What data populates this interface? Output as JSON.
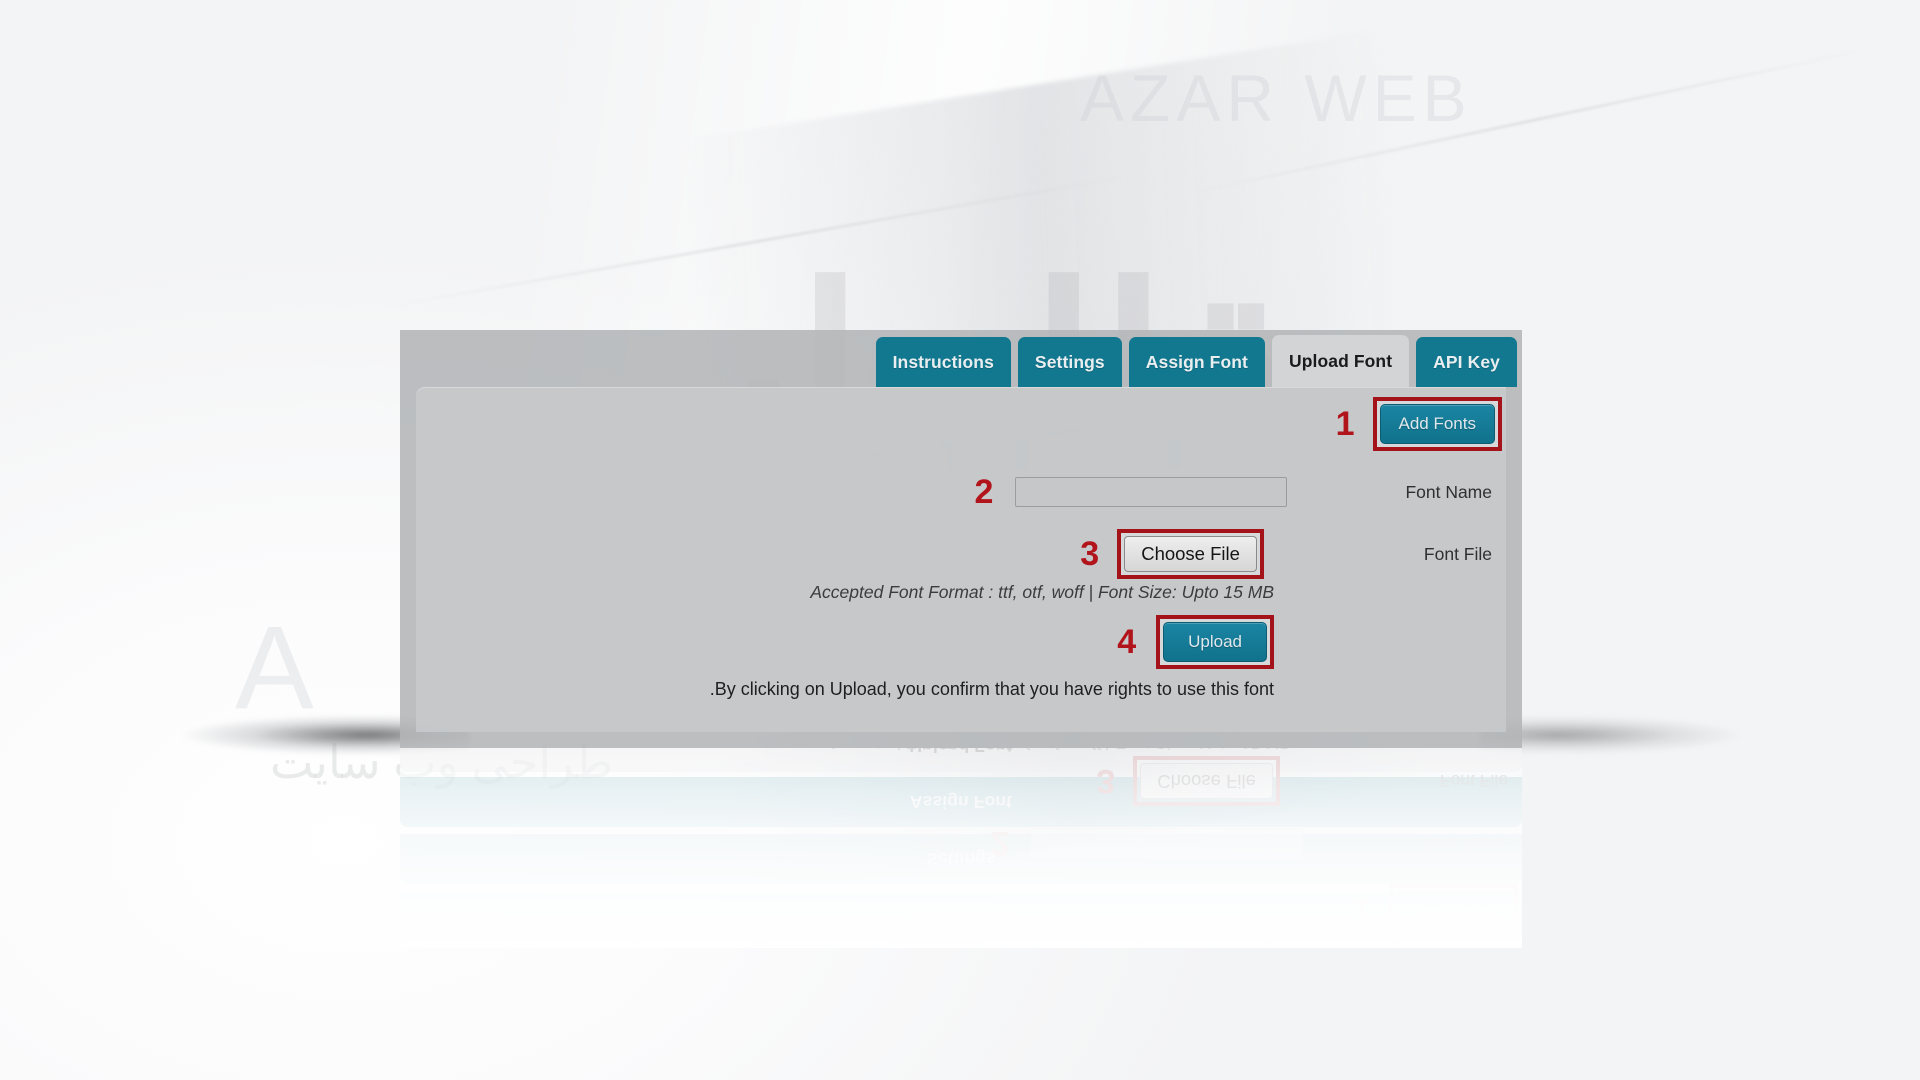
{
  "background": {
    "watermark_main": "قالبتاپ",
    "watermark_latin": "A Z A R S",
    "watermark_sub": "طراحی وب سایت",
    "watermark_faint": "AZAR WEB"
  },
  "panel": {
    "tabs": [
      {
        "label": "Instructions",
        "active": false
      },
      {
        "label": "Settings",
        "active": false
      },
      {
        "label": "Assign Font",
        "active": false
      },
      {
        "label": "Upload Font",
        "active": true
      },
      {
        "label": "API Key",
        "active": false
      }
    ],
    "form": {
      "add_fonts_button": "Add Fonts",
      "font_name_label": "Font Name",
      "font_name_value": "",
      "font_name_placeholder": "",
      "font_file_label": "Font File",
      "choose_file_button": "Choose File",
      "format_hint": "Accepted Font Format : ttf, otf, woff | Font Size: Upto 15 MB",
      "upload_button": "Upload",
      "confirm_text": ".By clicking on Upload, you confirm that you have rights to use this font"
    },
    "steps": {
      "one": "1",
      "two": "2",
      "three": "3",
      "four": "4"
    }
  },
  "colors": {
    "teal": "#11788f",
    "callout_red": "#a4131a",
    "step_red": "#b2141b",
    "panel_gray": "#b3b5b7",
    "inner_gray": "#c7c9cb",
    "active_tab": "#d3d4d6"
  }
}
